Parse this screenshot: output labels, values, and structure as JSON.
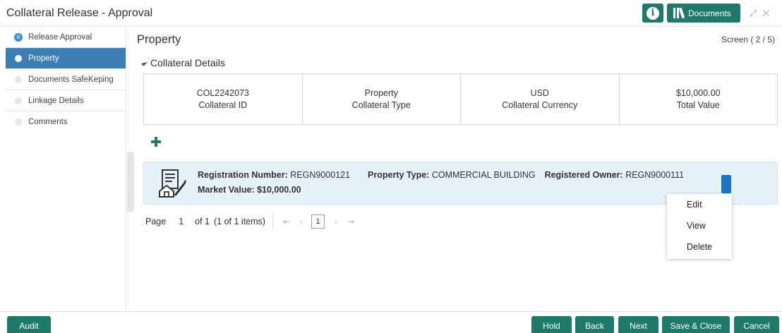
{
  "header": {
    "title": "Collateral Release - Approval",
    "info_icon": "i",
    "docs_label": "Documents"
  },
  "sidebar": {
    "items": [
      {
        "label": "Release Approval",
        "badge": "R"
      },
      {
        "label": "Property"
      },
      {
        "label": "Documents SafeKeping"
      },
      {
        "label": "Linkage Details"
      },
      {
        "label": "Comments"
      }
    ]
  },
  "main": {
    "title": "Property",
    "screen": "Screen ( 2 / 5)",
    "section": "Collateral Details",
    "summary": [
      {
        "value": "COL2242073",
        "label": "Collateral ID"
      },
      {
        "value": "Property",
        "label": "Collateral Type"
      },
      {
        "value": "USD",
        "label": "Collateral Currency"
      },
      {
        "value": "$10,000.00",
        "label": "Total Value"
      }
    ],
    "card": {
      "reg_label": "Registration Number:",
      "reg_value": "REGN9000121",
      "type_label": "Property Type:",
      "type_value": "COMMERCIAL BUILDING",
      "owner_label": "Registered Owner:",
      "owner_value": "REGN9000111",
      "market_label": "Market Value:",
      "market_value": "$10,000.00"
    },
    "menu": [
      "Edit",
      "View",
      "Delete"
    ],
    "pager": {
      "page_label": "Page",
      "page": "1",
      "of": "of 1",
      "items": "(1 of 1 items)",
      "current": "1"
    }
  },
  "footer": {
    "audit": "Audit",
    "hold": "Hold",
    "back": "Back",
    "next": "Next",
    "save_close": "Save & Close",
    "cancel": "Cancel"
  }
}
